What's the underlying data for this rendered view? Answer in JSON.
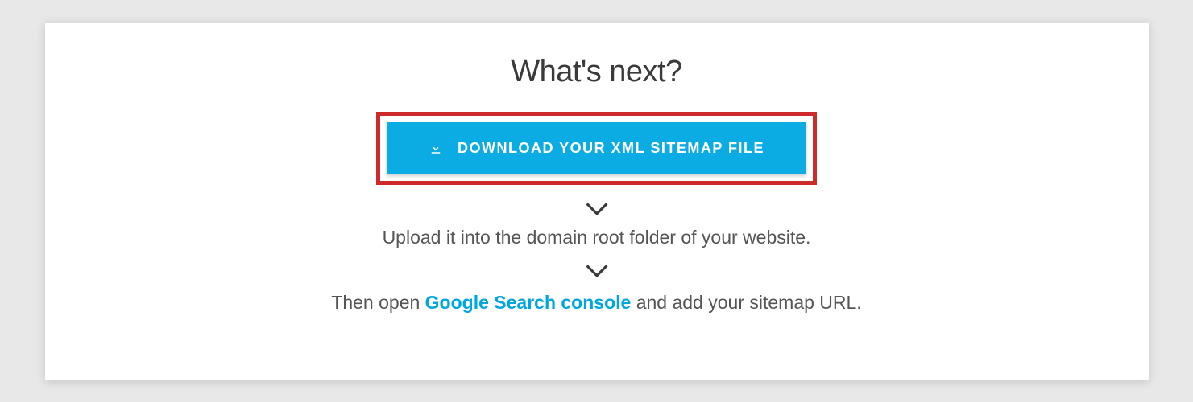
{
  "heading": "What's next?",
  "download_button": {
    "label": "DOWNLOAD YOUR XML SITEMAP FILE"
  },
  "step1": "Upload it into the domain root folder of your website.",
  "step2": {
    "prefix": "Then open ",
    "link_text": "Google Search console",
    "suffix": " and add your sitemap URL."
  }
}
